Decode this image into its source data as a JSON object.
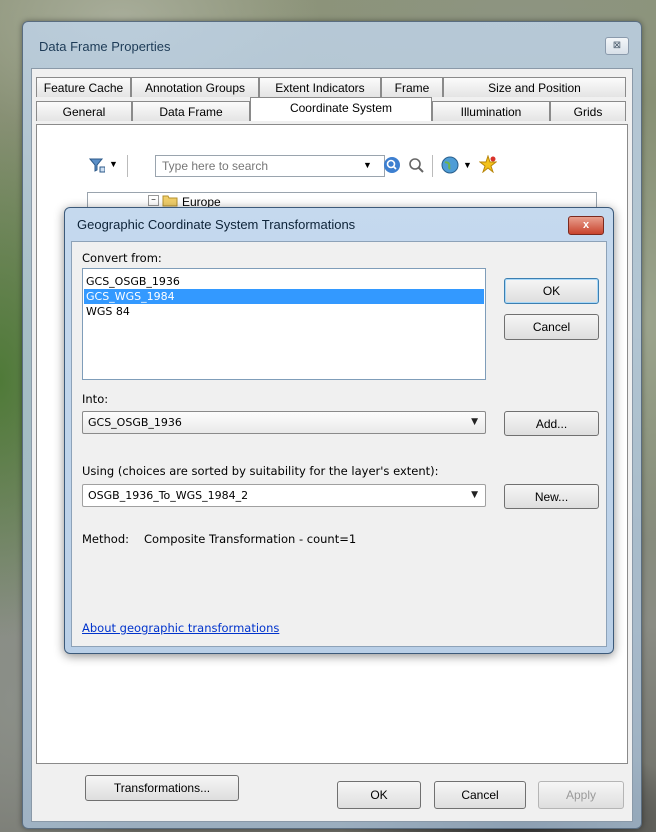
{
  "window": {
    "title": "Data Frame Properties",
    "close_glyph": "⊠",
    "tabs_row1": [
      "Feature Cache",
      "Annotation Groups",
      "Extent Indicators",
      "Frame",
      "Size and Position"
    ],
    "tabs_row2": [
      "General",
      "Data Frame",
      "Coordinate System",
      "Illumination",
      "Grids"
    ],
    "active_tab": "Coordinate System"
  },
  "toolbar": {
    "filter_icon": "filter-icon",
    "search_placeholder": "Type here to search",
    "tree_partial_label": "Europe"
  },
  "transformations_button": "Transformations...",
  "footer_buttons": {
    "ok": "OK",
    "cancel": "Cancel",
    "apply": "Apply"
  },
  "dialog": {
    "title": "Geographic Coordinate System Transformations",
    "close_glyph": "x",
    "convert_from_label": "Convert from:",
    "convert_from_items": [
      "GCS_OSGB_1936",
      "GCS_WGS_1984",
      "WGS 84"
    ],
    "selected_index": 1,
    "ok_label": "OK",
    "cancel_label": "Cancel",
    "into_label": "Into:",
    "into_value": "GCS_OSGB_1936",
    "add_label": "Add...",
    "using_label": "Using (choices are sorted by suitability for the layer's extent):",
    "using_value": "OSGB_1936_To_WGS_1984_2",
    "new_label": "New...",
    "method_label": "Method:",
    "method_value": "Composite Transformation - count=1",
    "about_link": "About geographic transformations"
  },
  "colors": {
    "selection": "#3399ff",
    "link": "#0033cc",
    "dialog_close": "#c8432d"
  }
}
